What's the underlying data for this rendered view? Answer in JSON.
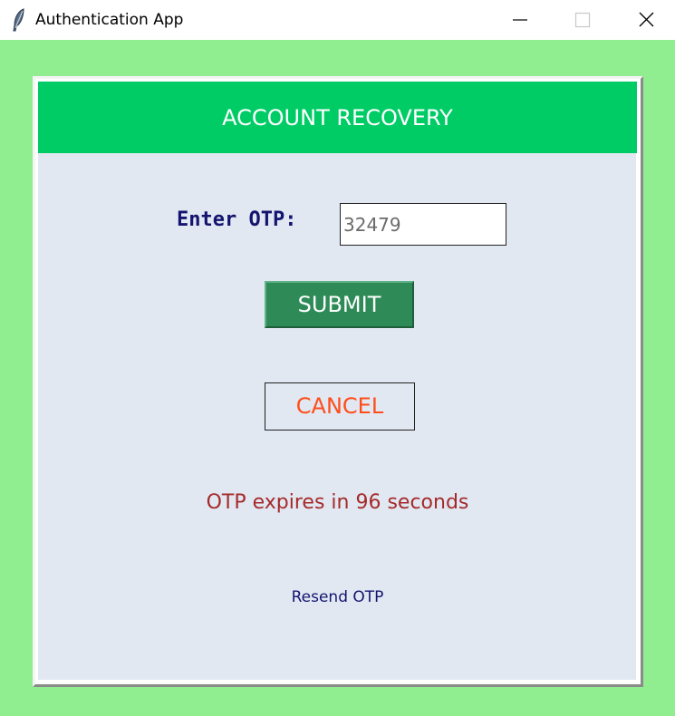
{
  "window": {
    "title": "Authentication App"
  },
  "header": {
    "title": "ACCOUNT RECOVERY"
  },
  "form": {
    "otp_label": "Enter OTP:",
    "otp_value": "32479",
    "submit_label": "SUBMIT",
    "cancel_label": "CANCEL",
    "expiry_text": "OTP expires in 96 seconds",
    "resend_label": "Resend OTP"
  },
  "colors": {
    "background": "#90ee90",
    "header": "#00cc66",
    "panel": "#e1e8f2",
    "submit": "#2e8b57",
    "cancel_text": "#ff4d1a",
    "expiry_text": "#a52a2a",
    "label_text": "#141470"
  },
  "icons": {
    "app": "feather-icon",
    "minimize": "minimize-icon",
    "maximize": "maximize-icon",
    "close": "close-icon"
  }
}
